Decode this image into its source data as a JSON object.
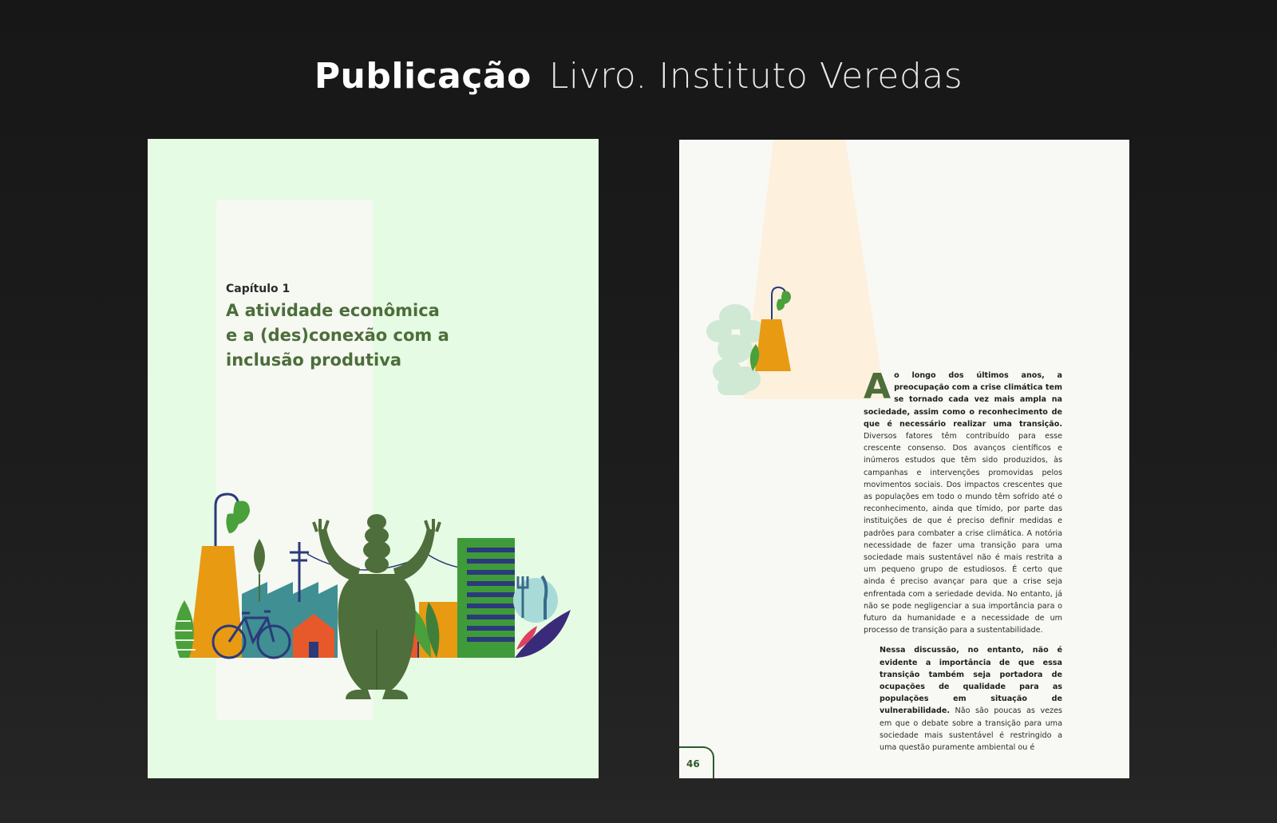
{
  "header": {
    "title_bold": "Publicação",
    "title_light": "Livro. Instituto Veredas"
  },
  "left_page": {
    "chapter_label": "Capítulo 1",
    "chapter_title": " A atividade econômica\ne a (des)conexão com a\ninclusão produtiva"
  },
  "right_page": {
    "dropcap": "A",
    "paragraph1_bold": "o longo dos últimos anos, a preocupação com a crise climática tem se tornado cada vez mais ampla na sociedade, assim como o reconhecimento de que é necessário realizar uma transição.",
    "paragraph1_rest": " Diversos fatores têm contribuído para esse crescente consenso. Dos avanços científicos e inúmeros estudos que têm sido produzidos, às campanhas e intervenções promovidas pelos movimentos sociais. Dos impactos crescentes que as populações em todo o mundo têm sofrido até o reconhecimento, ainda que tímido, por parte das instituições de que é preciso definir medidas e padrões para combater a crise climática. A notória necessidade de fazer uma transição para uma sociedade mais sustentável não é mais restrita a um pequeno grupo de estudiosos. É certo que ainda é preciso avançar para que a crise seja enfrentada com a seriedade devida. No entanto, já não se pode negligenciar a sua importância para o futuro da humanidade e a necessidade de um processo de transição para a sustentabilidade.",
    "paragraph2_bold": "Nessa discussão, no entanto, não é evidente a importância de que essa transição também seja portadora de ocupações de qualidade para as populações em situação de vulnerabilidade.",
    "paragraph2_rest": " Não são poucas as vezes em que o debate sobre a transição para uma sociedade mais sustentável é restringido a uma questão puramente ambiental ou é",
    "page_number": "46"
  },
  "colors": {
    "left_page_bg": "#e6fbe3",
    "right_page_bg": "#f8f9f4",
    "title_green": "#4c6e3a",
    "orange": "#e89a12",
    "teal": "#3f8f93",
    "dark_green": "#4e6e3c",
    "bright_green": "#4aa03a"
  }
}
